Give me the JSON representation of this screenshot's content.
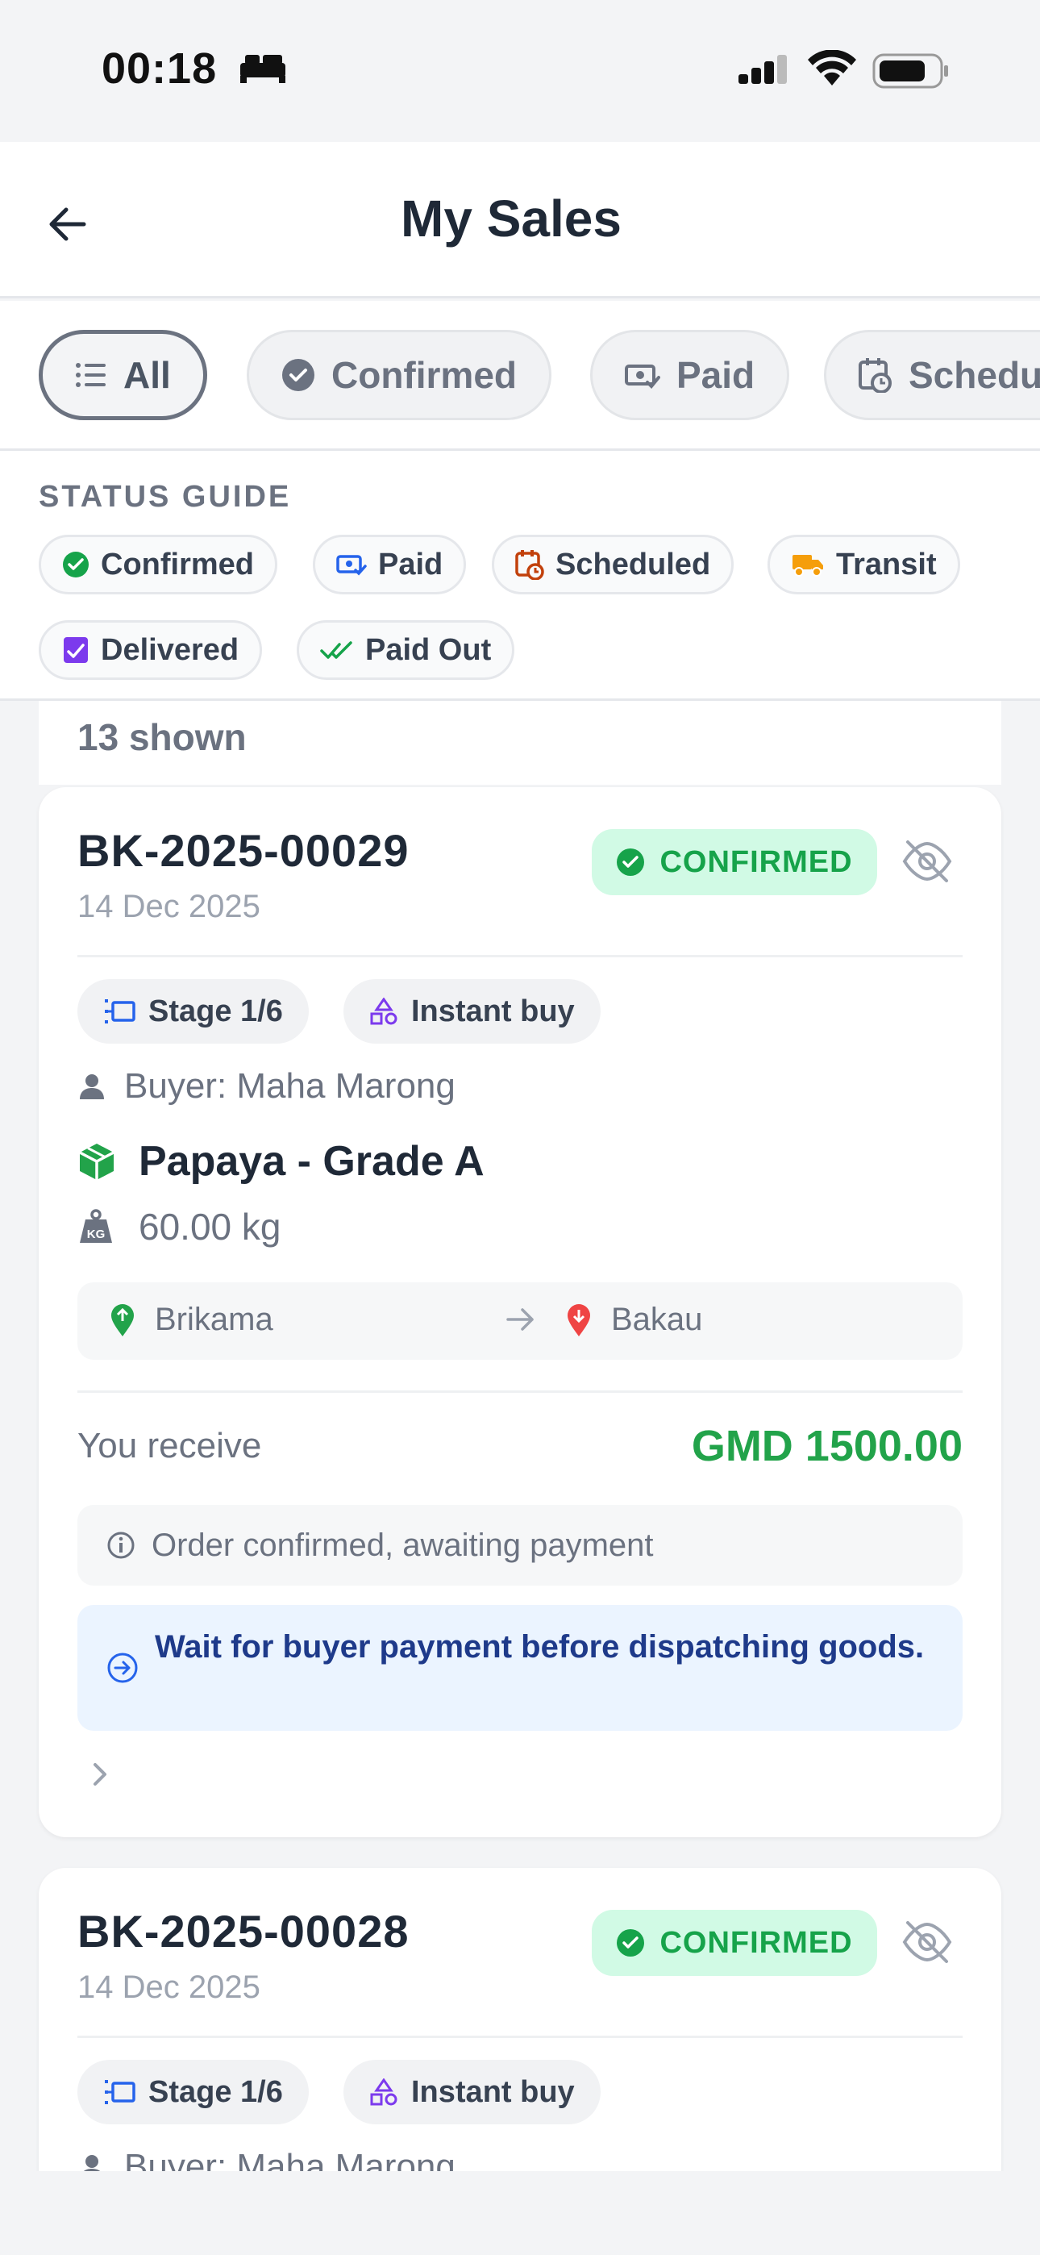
{
  "status_bar": {
    "time": "00:18"
  },
  "header": {
    "title": "My Sales"
  },
  "filters": [
    {
      "label": "All",
      "icon": "list-icon",
      "active": true
    },
    {
      "label": "Confirmed",
      "icon": "check-circle-icon"
    },
    {
      "label": "Paid",
      "icon": "money-icon"
    },
    {
      "label": "Scheduled",
      "icon": "calendar-clock-icon"
    }
  ],
  "status_guide": {
    "title": "STATUS GUIDE",
    "items": [
      {
        "label": "Confirmed",
        "icon": "check-circle-icon",
        "color": "#16a34a"
      },
      {
        "label": "Paid",
        "icon": "money-icon",
        "color": "#2563eb"
      },
      {
        "label": "Scheduled",
        "icon": "calendar-clock-icon",
        "color": "#c2410c"
      },
      {
        "label": "Transit",
        "icon": "truck-icon",
        "color": "#f59e0b"
      },
      {
        "label": "Delivered",
        "icon": "delivered-icon",
        "color": "#7c3aed"
      },
      {
        "label": "Paid Out",
        "icon": "double-check-icon",
        "color": "#16a34a"
      }
    ]
  },
  "count_text": "13 shown",
  "cards": [
    {
      "id": "BK-2025-00029",
      "date": "14 Dec 2025",
      "status": "CONFIRMED",
      "stage": "Stage 1/6",
      "type": "Instant buy",
      "buyer": "Buyer: Maha Marong",
      "product": "Papaya - Grade A",
      "weight": "60.00 kg",
      "from": "Brikama",
      "to": "Bakau",
      "receive_label": "You receive",
      "amount": "GMD 1500.00",
      "note": "Order confirmed, awaiting payment",
      "hint": "Wait for buyer payment before dispatching goods."
    },
    {
      "id": "BK-2025-00028",
      "date": "14 Dec 2025",
      "status": "CONFIRMED",
      "stage": "Stage 1/6",
      "type": "Instant buy",
      "buyer": "Buyer: Maha Marong"
    }
  ]
}
